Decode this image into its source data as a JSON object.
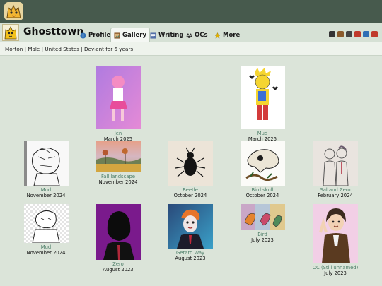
{
  "profile": {
    "username": "Ghosttown",
    "info": "Morton | Male | United States | Deviant for 6 years"
  },
  "tabs": [
    {
      "label": "Profile",
      "icon": "info-icon",
      "color": "#2f6fb5"
    },
    {
      "label": "Gallery",
      "icon": "frame-icon",
      "color": "#8a5a2b"
    },
    {
      "label": "Writing",
      "icon": "document-icon",
      "color": "#5470a8"
    },
    {
      "label": "OCs",
      "icon": "paw-icon",
      "color": "#2e2e2e"
    },
    {
      "label": "More",
      "icon": "star-icon",
      "color": "#e0b000"
    }
  ],
  "header_badges": [
    {
      "icon": "glasses-icon",
      "color": "#333333"
    },
    {
      "icon": "coffee-icon",
      "color": "#8a5a2b"
    },
    {
      "icon": "robot-icon",
      "color": "#444444"
    },
    {
      "icon": "bug-icon",
      "color": "#c0392b"
    },
    {
      "icon": "monitor-icon",
      "color": "#2f6fb5"
    },
    {
      "icon": "camera-icon",
      "color": "#c0392b"
    }
  ],
  "gallery": [
    {
      "title": "Jen",
      "date": "March 2025"
    },
    {
      "title": "Mud",
      "date": "March 2025"
    },
    {
      "title": "Mud",
      "date": "November 2024"
    },
    {
      "title": "Fall landscape",
      "date": "November 2024"
    },
    {
      "title": "Beetle",
      "date": "October 2024"
    },
    {
      "title": "Bird skull",
      "date": "October 2024"
    },
    {
      "title": "Sal and Zero",
      "date": "February 2024"
    },
    {
      "title": "Mud",
      "date": "November 2024"
    },
    {
      "title": "Zero",
      "date": "August 2023"
    },
    {
      "title": "Gerard Way",
      "date": "August 2023"
    },
    {
      "title": "Bird",
      "date": "July 2023"
    },
    {
      "title": "OC (Still unnamed)",
      "date": "July 2023"
    }
  ]
}
